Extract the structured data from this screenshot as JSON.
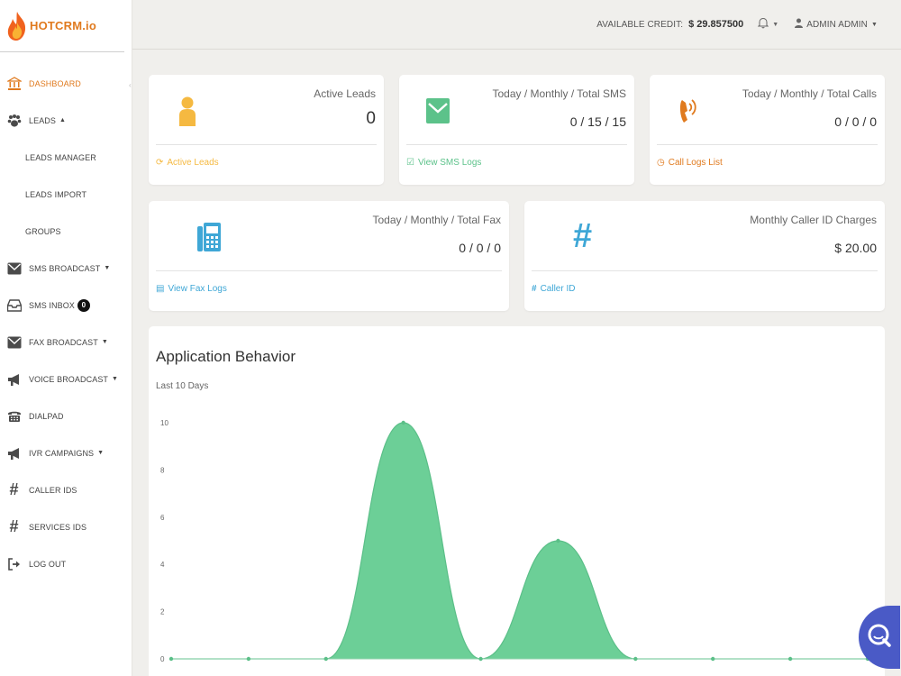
{
  "logo": {
    "text": "HOTCRM.io"
  },
  "nav": {
    "dashboard": "DASHBOARD",
    "leads": "LEADS",
    "leads_manager": "LEADS MANAGER",
    "leads_import": "LEADS IMPORT",
    "groups": "GROUPS",
    "sms_broadcast": "SMS BROADCAST",
    "sms_inbox": "SMS INBOX",
    "sms_inbox_count": "0",
    "fax_broadcast": "FAX BROADCAST",
    "voice_broadcast": "VOICE BROADCAST",
    "dialpad": "DIALPAD",
    "ivr_campaigns": "IVR CAMPAIGNS",
    "caller_ids": "CALLER IDS",
    "services_ids": "SERVICES IDS",
    "log_out": "LOG OUT"
  },
  "topbar": {
    "credit_label": "AVAILABLE CREDIT:",
    "credit_value": "$ 29.857500",
    "admin_label": "ADMIN ADMIN"
  },
  "cards": {
    "active_leads": {
      "title": "Active Leads",
      "value": "0",
      "link": "Active Leads"
    },
    "sms": {
      "title": "Today / Monthly / Total SMS",
      "value": "0 / 15 / 15",
      "link": "View SMS Logs"
    },
    "calls": {
      "title": "Today / Monthly / Total Calls",
      "value": "0 / 0 / 0",
      "link": "Call Logs List"
    },
    "fax": {
      "title": "Today / Monthly / Total Fax",
      "value": "0 / 0 / 0",
      "link": "View Fax Logs"
    },
    "caller_id": {
      "title": "Monthly Caller ID Charges",
      "value": "$ 20.00",
      "link": "Caller ID"
    }
  },
  "colors": {
    "accent": "#e07a1e",
    "gold": "#f5b941",
    "green": "#5cc28a",
    "blue": "#3fa7d6",
    "chart_fill": "#6ccf97",
    "chat": "#4a5ac6"
  },
  "chart": {
    "title": "Application Behavior",
    "subtitle": "Last 10 Days"
  },
  "chart_data": {
    "type": "area",
    "title": "Application Behavior",
    "subtitle": "Last 10 Days",
    "x": [
      0,
      1,
      2,
      3,
      4,
      5,
      6,
      7,
      8,
      9
    ],
    "ylim": [
      0,
      10
    ],
    "yticks": [
      "0",
      "2",
      "4",
      "6",
      "8",
      "10"
    ],
    "series": [
      {
        "values": [
          0,
          0,
          0,
          10,
          0,
          5,
          0,
          0,
          0,
          0
        ]
      }
    ],
    "grid": false
  }
}
